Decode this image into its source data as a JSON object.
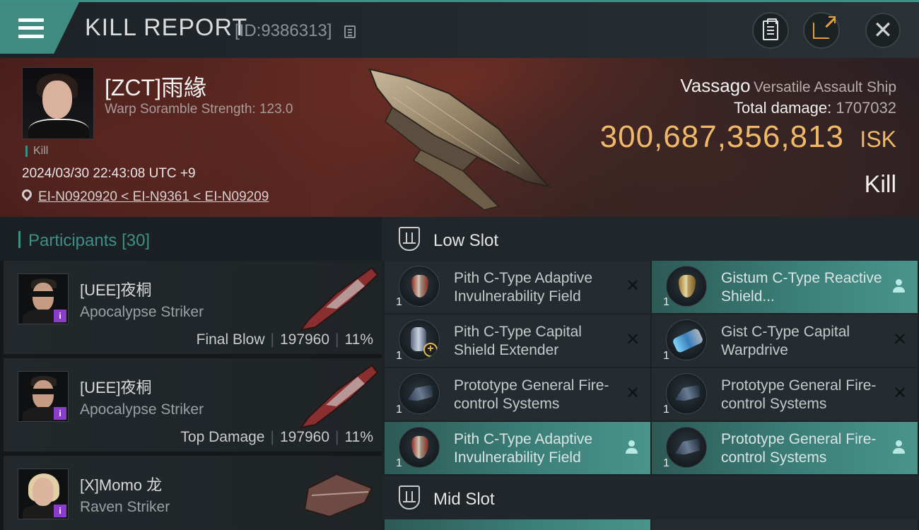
{
  "header": {
    "title": "KILL REPORT",
    "report_id": "[ID:9386313]"
  },
  "victim": {
    "pilot": "[ZCT]雨緣",
    "stat_line": "Warp Soramble Strength: 123.0",
    "tag": "Kill",
    "timestamp": "2024/03/30 22:43:08 UTC +9",
    "location": "EI-N0920920 < EI-N9361 < EI-N09209",
    "ship_name": "Vassago",
    "ship_class": "Versatile Assault Ship",
    "total_damage_label": "Total damage:",
    "total_damage": "1707032",
    "isk_value": "300,687,356,813",
    "isk_unit": "ISK",
    "result": "Kill"
  },
  "participants": {
    "label": "Participants",
    "count": "[30]",
    "rows": [
      {
        "name": "[UEE]夜桐",
        "ship": "Apocalypse Striker",
        "role": "Final Blow",
        "damage": "197960",
        "percent": "11%"
      },
      {
        "name": "[UEE]夜桐",
        "ship": "Apocalypse Striker",
        "role": "Top Damage",
        "damage": "197960",
        "percent": "11%"
      },
      {
        "name": "[X]Momo 龙",
        "ship": "Raven Striker",
        "role": "",
        "damage": "",
        "percent": ""
      }
    ]
  },
  "slots": {
    "low_slot_label": "Low Slot",
    "mid_slot_label": "Mid Slot",
    "low_items": [
      {
        "qty": "1",
        "name": "Pith C-Type Adaptive Invulnerability Field",
        "icon": "shield-red-icon",
        "state": "destroyed"
      },
      {
        "qty": "1",
        "name": "Gistum C-Type Reactive Shield...",
        "icon": "shield-gold-icon",
        "state": "dropped"
      },
      {
        "qty": "1",
        "name": "Pith C-Type Capital Shield Extender",
        "icon": "shield-extender-icon",
        "state": "destroyed"
      },
      {
        "qty": "1",
        "name": "Gist C-Type Capital Warpdrive",
        "icon": "warpdrive-icon",
        "state": "destroyed"
      },
      {
        "qty": "1",
        "name": "Prototype General Fire-control Systems",
        "icon": "fire-control-icon",
        "state": "destroyed"
      },
      {
        "qty": "1",
        "name": "Prototype General Fire-control Systems",
        "icon": "fire-control-icon",
        "state": "destroyed"
      },
      {
        "qty": "1",
        "name": "Pith C-Type Adaptive Invulnerability Field",
        "icon": "shield-red-icon",
        "state": "dropped"
      },
      {
        "qty": "1",
        "name": "Prototype General Fire-control Systems",
        "icon": "fire-control-icon",
        "state": "dropped"
      }
    ]
  },
  "colors": {
    "accent": "#3e8f85",
    "isk": "#f0b96a",
    "dropped_bg": "#3b7f78"
  }
}
